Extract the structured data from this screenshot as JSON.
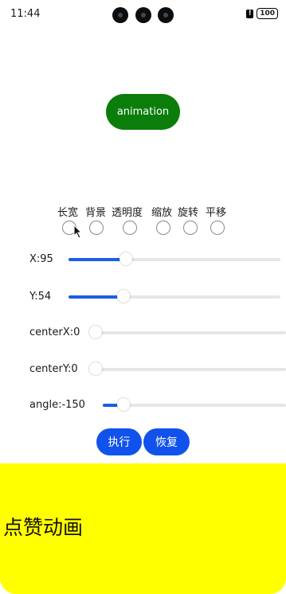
{
  "status": {
    "time": "11:44",
    "battery": "100"
  },
  "animation_button": {
    "label": "animation",
    "color": "#0b7d0b"
  },
  "options": [
    "长宽",
    "背景",
    "透明度",
    "缩放",
    "旋转",
    "平移"
  ],
  "sliders": {
    "x": {
      "label": "X:95",
      "value_fraction": 0.24
    },
    "y": {
      "label": "Y:54",
      "value_fraction": 0.23
    },
    "center_x": {
      "label": "centerX:0",
      "value_fraction": 0.0
    },
    "center_y": {
      "label": "centerY:0",
      "value_fraction": 0.0
    },
    "angle": {
      "label": "angle:-150",
      "value_fraction": 0.08
    }
  },
  "actions": {
    "execute": "执行",
    "restore": "恢复",
    "accent": "#1152ec"
  },
  "like_panel": {
    "text": "点赞动画",
    "color": "#ffff00"
  }
}
